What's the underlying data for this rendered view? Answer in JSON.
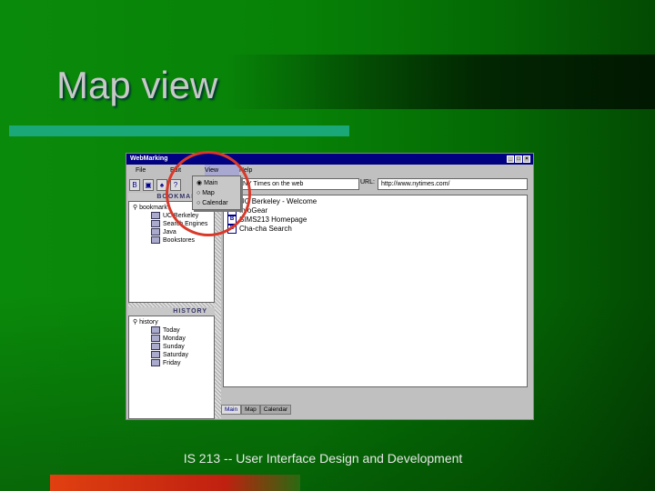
{
  "slide": {
    "title": "Map view",
    "footer": "IS 213 -- User Interface Design and Development"
  },
  "window": {
    "title": "WebMarking",
    "controls": [
      "_",
      "□",
      "×"
    ]
  },
  "menu": [
    "File",
    "Edit",
    "View",
    "Help"
  ],
  "view_menu": [
    {
      "label": "Main",
      "selected": true
    },
    {
      "label": "Map",
      "selected": false
    },
    {
      "label": "Calendar",
      "selected": false
    }
  ],
  "toolbar": {
    "icons": [
      "B",
      "open",
      "binoculars",
      "?"
    ],
    "title_field": "NY Times on the web",
    "url_label": "URL:",
    "url_value": "http://www.nytimes.com/"
  },
  "bookmarks": {
    "header": "BOOKMARKS",
    "root": "bookmark",
    "items": [
      "UC Berkeley",
      "Search Engines",
      "Java",
      "Bookstores"
    ]
  },
  "history": {
    "header": "HISTORY",
    "root": "history",
    "items": [
      "Today",
      "Monday",
      "Sunday",
      "Saturday",
      "Friday"
    ]
  },
  "list": [
    "UC Berkeley - Welcome",
    "InfoGear",
    "SIMS213 Homepage",
    "Cha-cha Search"
  ],
  "tabs": [
    "Main",
    "Map",
    "Calendar"
  ]
}
